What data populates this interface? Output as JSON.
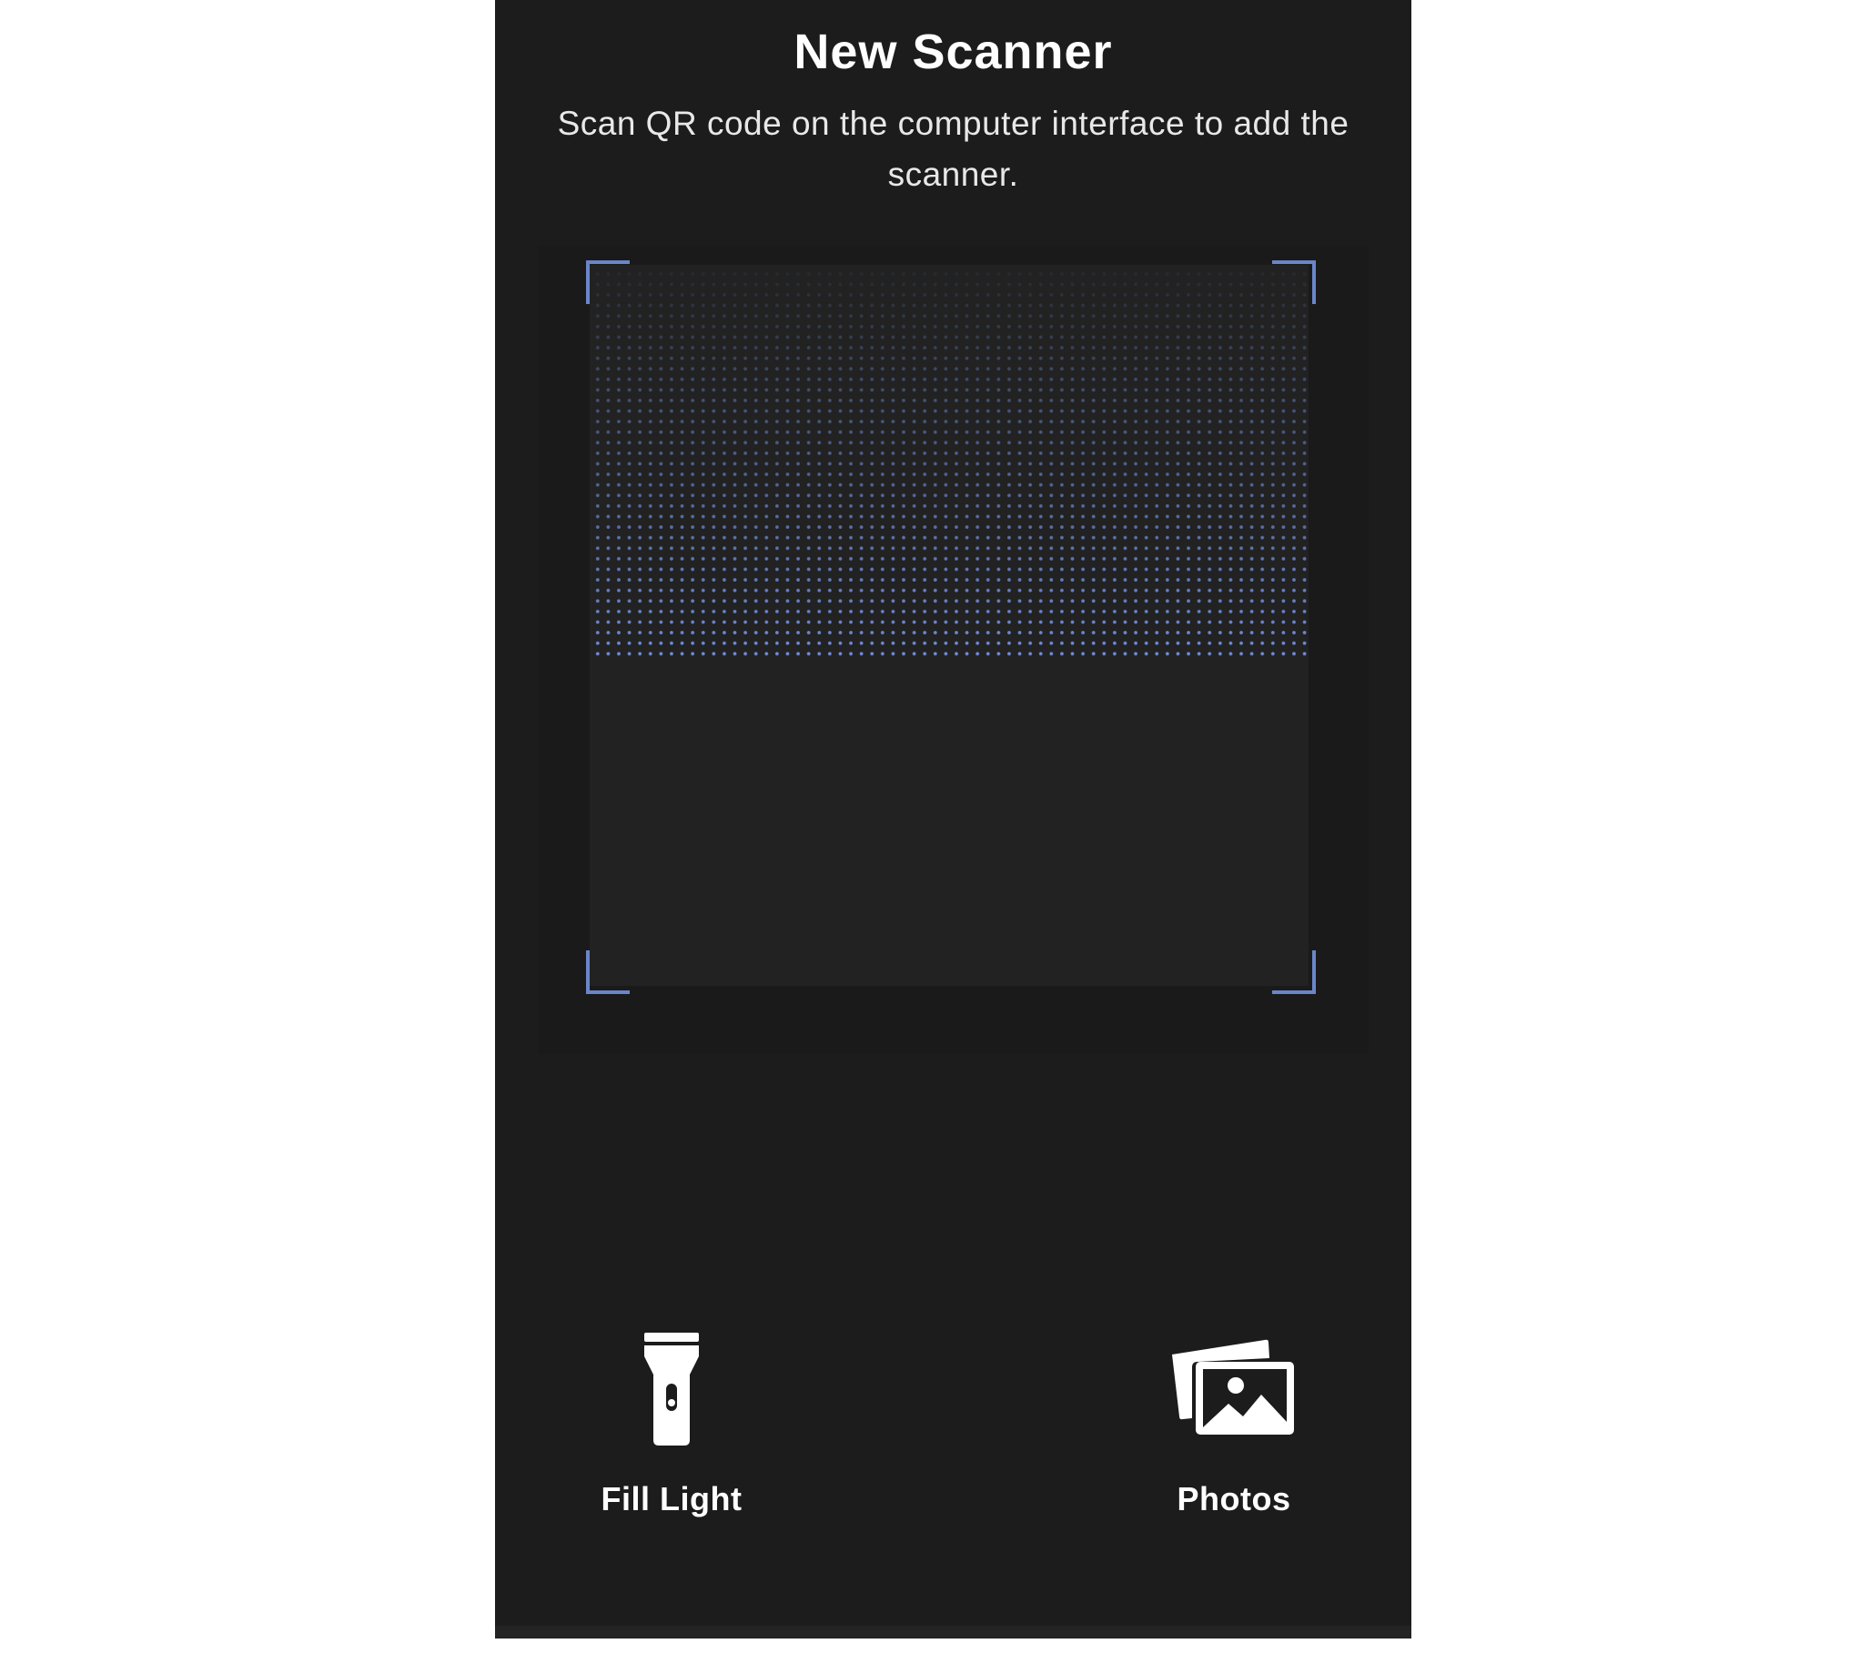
{
  "header": {
    "title": "New Scanner",
    "subtitle": "Scan QR code on the computer interface to add the scanner."
  },
  "scanner": {
    "frame_color": "#6a86c8",
    "dot_color": "#6f8ddb"
  },
  "actions": {
    "fill_light": {
      "label": "Fill Light",
      "icon": "flashlight-icon"
    },
    "photos": {
      "label": "Photos",
      "icon": "photos-icon"
    }
  },
  "colors": {
    "background": "#1c1c1c",
    "text": "#ffffff"
  }
}
